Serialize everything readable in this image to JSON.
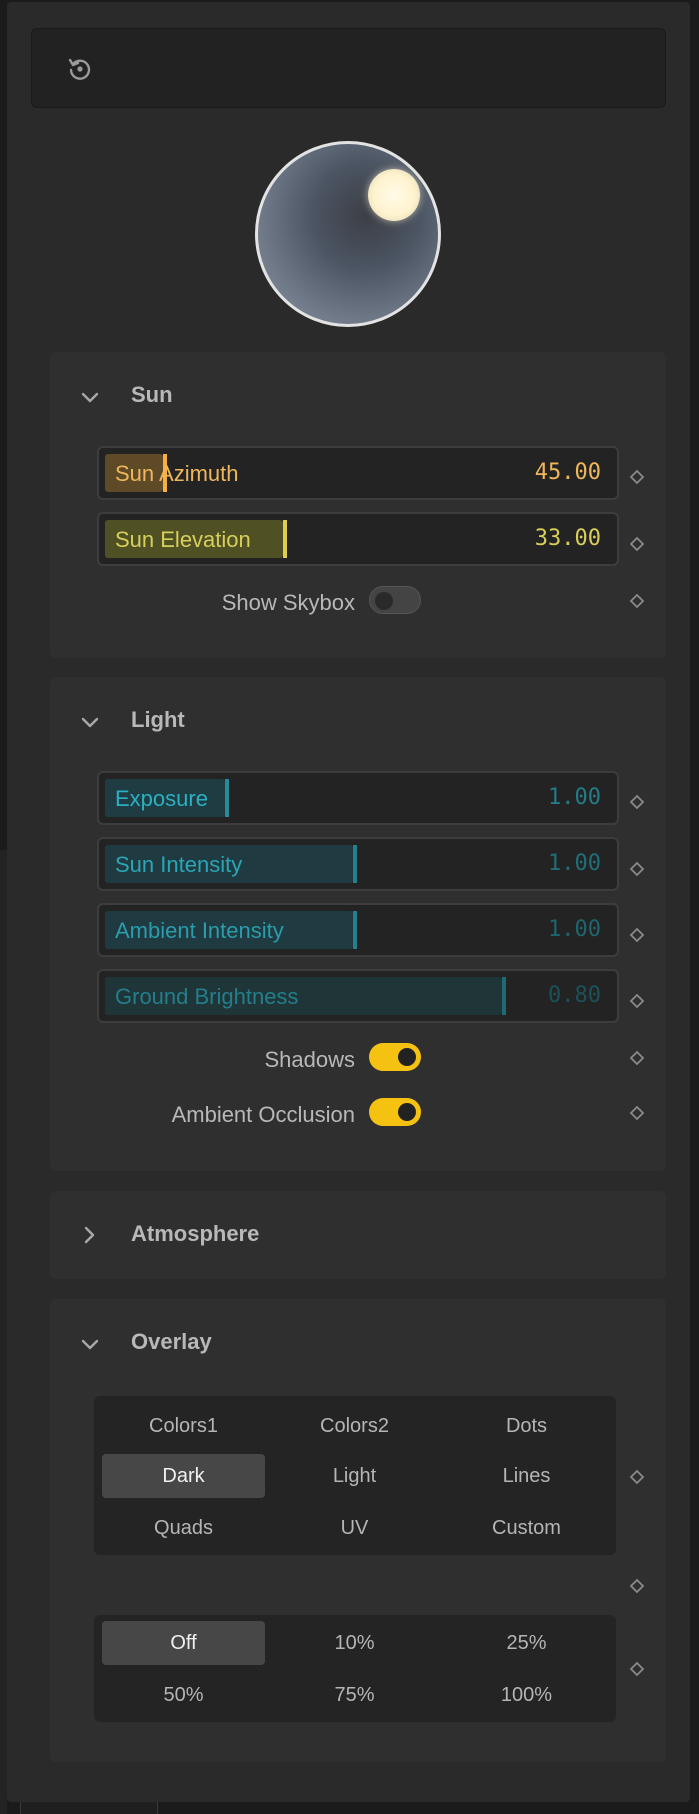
{
  "colors": {
    "accent_orange": "#f5b041",
    "accent_yellow": "#d6c64a",
    "accent_teal": "#2aa8b8",
    "toggle_on": "#f5c211"
  },
  "toolbar": {
    "reset_icon": "reset-icon"
  },
  "sun": {
    "title": "Sun",
    "azimuth": {
      "label": "Sun Azimuth",
      "value": "45.00",
      "fraction": 0.125
    },
    "elevation": {
      "label": "Sun Elevation",
      "value": "33.00",
      "fraction": 0.367
    },
    "show_skybox": {
      "label": "Show Skybox",
      "on": false
    }
  },
  "light": {
    "title": "Light",
    "exposure": {
      "label": "Exposure",
      "value": "1.00",
      "fraction": 0.22
    },
    "sun_intensity": {
      "label": "Sun Intensity",
      "value": "1.00",
      "fraction": 0.5
    },
    "ambient_intensity": {
      "label": "Ambient Intensity",
      "value": "1.00",
      "fraction": 0.5
    },
    "ground_brightness": {
      "label": "Ground Brightness",
      "value": "0.80",
      "fraction": 0.8
    },
    "shadows": {
      "label": "Shadows",
      "on": true
    },
    "ambient_occlusion": {
      "label": "Ambient Occlusion",
      "on": true
    }
  },
  "atmosphere": {
    "title": "Atmosphere"
  },
  "overlay": {
    "title": "Overlay",
    "textures": [
      "Colors1",
      "Colors2",
      "Dots",
      "Dark",
      "Light",
      "Lines",
      "Quads",
      "UV",
      "Custom"
    ],
    "texture_selected": "Dark",
    "opacity": [
      "Off",
      "10%",
      "25%",
      "50%",
      "75%",
      "100%"
    ],
    "opacity_selected": "Off"
  }
}
